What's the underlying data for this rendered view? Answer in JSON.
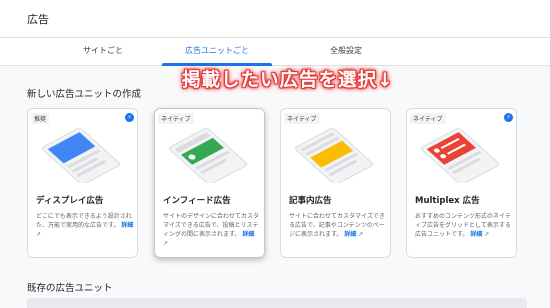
{
  "header": {
    "title": "広告"
  },
  "tabs": [
    {
      "label": "サイトごと",
      "active": false
    },
    {
      "label": "広告ユニットごと",
      "active": true
    },
    {
      "label": "全般設定",
      "active": false
    }
  ],
  "section": {
    "title": "新しい広告ユニットの作成"
  },
  "overlay_text": "掲載したい広告を選択↓",
  "cards": [
    {
      "badge": "推奨",
      "name": "ディスプレイ広告",
      "desc": "どこにでも表示できるよう設計された、万能で実用的な広告です。",
      "link": "詳細",
      "bolt": true,
      "accent": "#4285f4"
    },
    {
      "badge": "ネイティブ",
      "name": "インフィード広告",
      "desc": "サイトのデザインに合わせてカスタマイズできる広告で、投稿とリスティングの間に表示されます。",
      "link": "詳細",
      "bolt": false,
      "accent": "#34a853"
    },
    {
      "badge": "ネイティブ",
      "name": "記事内広告",
      "desc": "サイトに合わせてカスタマイズできる広告で、記事やコンテンツのページに表示されます。",
      "link": "詳細",
      "bolt": false,
      "accent": "#fbbc04"
    },
    {
      "badge": "ネイティブ",
      "name": "Multiplex 広告",
      "desc": "おすすめのコンテンツ形式のネイティブ広告をグリッドとして表示する広告ユニットです。",
      "link": "詳細",
      "bolt": true,
      "accent": "#ea4335"
    }
  ],
  "existing": {
    "title": "既存の広告ユニット"
  }
}
